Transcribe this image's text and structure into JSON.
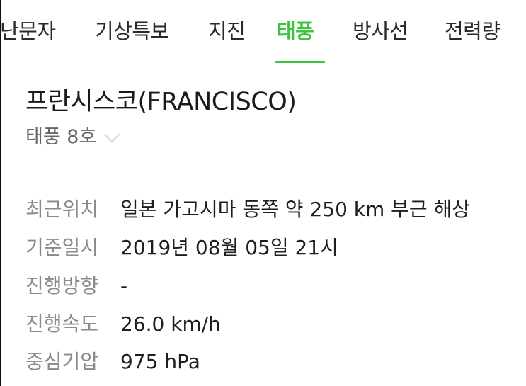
{
  "tabs": [
    {
      "label": "난문자",
      "active": false
    },
    {
      "label": "기상특보",
      "active": false
    },
    {
      "label": "지진",
      "active": false
    },
    {
      "label": "태풍",
      "active": true
    },
    {
      "label": "방사선",
      "active": false
    },
    {
      "label": "전력량",
      "active": false
    }
  ],
  "typhoon": {
    "name": "프란시스코(FRANCISCO)",
    "number": "태풍 8호"
  },
  "details": [
    {
      "label": "최근위치",
      "value": "일본 가고시마 동쪽 약 250 km 부근 해상"
    },
    {
      "label": "기준일시",
      "value": "2019년 08월 05일 21시"
    },
    {
      "label": "진행방향",
      "value": "-"
    },
    {
      "label": "진행속도",
      "value": "26.0 km/h"
    },
    {
      "label": "중심기압",
      "value": "975 hPa"
    }
  ],
  "colors": {
    "accent": "#3dc43d",
    "label": "#8a8a8a",
    "text": "#1e1e1e"
  },
  "icons": {
    "subtitle_dropdown": "chevron-down-icon"
  }
}
